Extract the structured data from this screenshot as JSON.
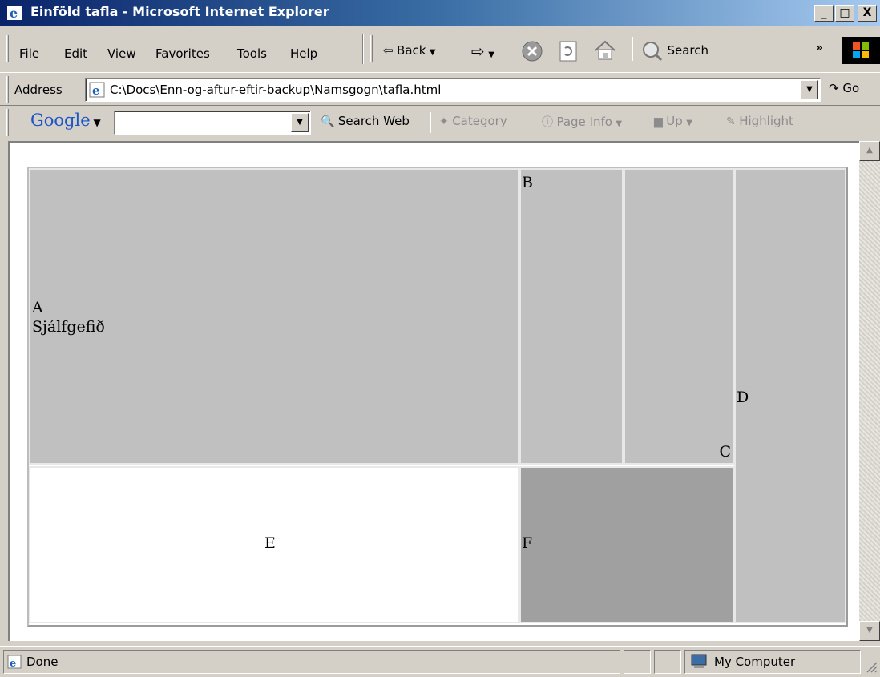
{
  "window": {
    "title": "Einföld tafla - Microsoft Internet Explorer",
    "controls": {
      "minimize": "_",
      "maximize": "□",
      "close": "X"
    }
  },
  "menu": [
    "File",
    "Edit",
    "View",
    "Favorites",
    "Tools",
    "Help"
  ],
  "toolbar": {
    "back_label": "Back",
    "forward_icon": "⇨",
    "stop_icon": "stop-icon",
    "refresh_icon": "refresh-icon",
    "home_icon": "home-icon",
    "search_label": "Search",
    "overflow": "»"
  },
  "address": {
    "label": "Address",
    "value": "C:\\Docs\\Enn-og-aftur-eftir-backup\\Namsgogn\\tafla.html",
    "go_label": "Go"
  },
  "google": {
    "brand": "Google",
    "search_value": "",
    "search_web_label": "Search Web",
    "category_label": "Category",
    "page_info_label": "Page Info",
    "up_label": "Up",
    "highlight_label": "Highlight"
  },
  "table": {
    "cell_a_line1": "A",
    "cell_a_line2": "Sjálfgefið",
    "cell_b": "B",
    "cell_c": "C",
    "cell_d": "D",
    "cell_e": "E",
    "cell_f": "F",
    "colors": {
      "light_gray": "#c0c0c0",
      "dark_gray": "#a0a0a0",
      "white": "#ffffff"
    }
  },
  "status": {
    "text": "Done",
    "zone": "My Computer"
  }
}
